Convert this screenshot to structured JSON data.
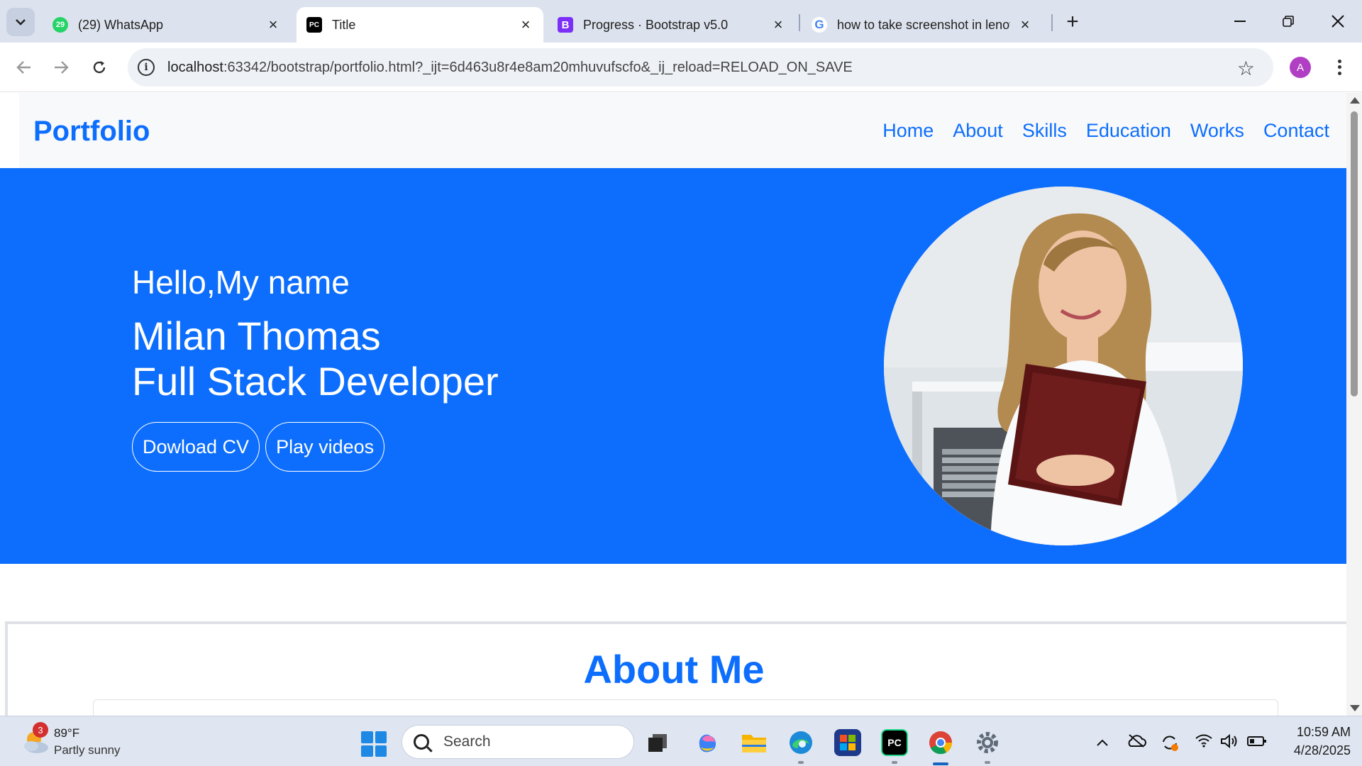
{
  "browser": {
    "tabs": [
      {
        "title": "(29) WhatsApp",
        "badge": "29",
        "active": false
      },
      {
        "title": "Title",
        "favicon_text": "PC",
        "active": true
      },
      {
        "title": "Progress · Bootstrap v5.0",
        "favicon_text": "B",
        "active": false
      },
      {
        "title": "how to take screenshot in lenov",
        "favicon_text": "G",
        "active": false
      }
    ],
    "url_host": "localhost",
    "url_rest": ":63342/bootstrap/portfolio.html?_ijt=6d463u8r4e8am20mhuvufscfo&_ij_reload=RELOAD_ON_SAVE",
    "profile_initial": "A"
  },
  "site": {
    "brand": "Portfolio",
    "nav": [
      "Home",
      "About",
      "Skills",
      "Education",
      "Works",
      "Contact"
    ],
    "hero": {
      "greeting": "Hello,My name",
      "name": "Milan Thomas",
      "role": "Full Stack Developer",
      "download_label": "Dowload CV",
      "videos_label": "Play videos"
    },
    "about_title": "About Me"
  },
  "taskbar": {
    "weather_badge": "3",
    "weather_temp": "89°F",
    "weather_desc": "Partly sunny",
    "search_label": "Search",
    "time": "10:59 AM",
    "date": "4/28/2025"
  },
  "colors": {
    "primary": "#0d6efd",
    "nav_bg": "#f8f9fa",
    "active_app_indicator": "#1565c0"
  }
}
